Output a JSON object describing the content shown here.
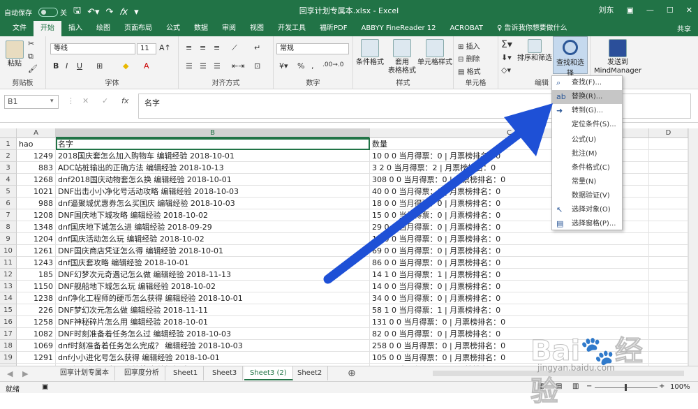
{
  "titlebar": {
    "autosave": "自动保存",
    "autosave_state": "关",
    "title": "回享计划专属本.xlsx  -  Excel",
    "user": "刘东"
  },
  "tabs": [
    "文件",
    "开始",
    "插入",
    "绘图",
    "页面布局",
    "公式",
    "数据",
    "审阅",
    "视图",
    "开发工具",
    "福昕PDF",
    "ABBYY FineReader 12",
    "ACROBAT",
    "♀ 告诉我你想要做什么"
  ],
  "tabs_active": 1,
  "share": "共享",
  "ribbon": {
    "paste": "粘贴",
    "clipboard": "剪贴板",
    "font_name": "等线",
    "font_size": "11",
    "font_group": "字体",
    "align_group": "对齐方式",
    "number_format": "常规",
    "number_group": "数字",
    "cond_format": "条件格式",
    "table_format": "套用\n表格格式",
    "cell_style": "单元格样式",
    "style_group": "样式",
    "insert": "插入",
    "delete": "删除",
    "format": "格式",
    "cells_group": "单元格",
    "sort_filter": "排序和筛选",
    "find_select": "查找和选择",
    "edit_group": "编辑",
    "send_mindmanager": "发送到\nMindManager"
  },
  "formula_bar": {
    "name_box": "B1",
    "fx": "fx",
    "content": "名字"
  },
  "columns": [
    "A",
    "B",
    "C",
    "D"
  ],
  "rows": [
    {
      "n": "1",
      "a": "hao",
      "b": "名字",
      "c": "数量"
    },
    {
      "n": "2",
      "a": "1249",
      "b": "2018国庆套怎么加入购物车 编辑经验 2018-10-01",
      "c": "10 0 0 当月得票：0 | 月票榜排名：0"
    },
    {
      "n": "3",
      "a": "883",
      "b": "ADC站桩输出的正确方法 编辑经验 2018-10-13",
      "c": "3 2 0 当月得票：2 | 月票榜排名：0"
    },
    {
      "n": "4",
      "a": "1268",
      "b": "dnf2018国庆动物套怎么换 编辑经验 2018-10-01",
      "c": "308 0 0 当月得票：0 | 月票榜排名：0"
    },
    {
      "n": "5",
      "a": "1021",
      "b": "DNF出击小小净化号活动攻略 编辑经验 2018-10-03",
      "c": "40 0 0 当月得票：0 | 月票榜排名：0"
    },
    {
      "n": "6",
      "a": "988",
      "b": "dnf逼聚城优惠券怎么买国庆 编辑经验 2018-10-03",
      "c": "18 0 0 当月得票：0 | 月票榜排名：0"
    },
    {
      "n": "7",
      "a": "1208",
      "b": "DNF国庆地下城攻略 编辑经验 2018-10-02",
      "c": "15 0 0 当月得票：0 | 月票榜排名：0"
    },
    {
      "n": "8",
      "a": "1348",
      "b": "dnf国庆地下城怎么进 编辑经验 2018-09-29",
      "c": "29 0 0 当月得票：0 | 月票榜排名：0"
    },
    {
      "n": "9",
      "a": "1204",
      "b": "dnf国庆活动怎么玩 编辑经验 2018-10-02",
      "c": "11 0 0 当月得票：0 | 月票榜排名：0"
    },
    {
      "n": "10",
      "a": "1261",
      "b": "DNF国庆商店凭证怎么得 编辑经验 2018-10-01",
      "c": "69 0 0 当月得票：0 | 月票榜排名：0"
    },
    {
      "n": "11",
      "a": "1243",
      "b": "dnf国庆套攻略 编辑经验 2018-10-01",
      "c": "86 0 0 当月得票：0 | 月票榜排名：0"
    },
    {
      "n": "12",
      "a": "185",
      "b": "DNF幻梦次元奇遇记怎么做 编辑经验 2018-11-13",
      "c": "14 1 0 当月得票：1 | 月票榜排名：0"
    },
    {
      "n": "13",
      "a": "1150",
      "b": "DNF舰船地下城怎么玩 编辑经验 2018-10-02",
      "c": "14 0 0 当月得票：0 | 月票榜排名：0"
    },
    {
      "n": "14",
      "a": "1238",
      "b": "dnf净化工程师的硬币怎么获得 编辑经验 2018-10-01",
      "c": "34 0 0 当月得票：0 | 月票榜排名：0"
    },
    {
      "n": "15",
      "a": "226",
      "b": "DNF梦幻次元怎么做 编辑经验 2018-11-11",
      "c": "58 1 0 当月得票：1 | 月票榜排名：0"
    },
    {
      "n": "16",
      "a": "1258",
      "b": "DNF神秘碎片怎么用 编辑经验 2018-10-01",
      "c": "131 0 0 当月得票：0 | 月票榜排名：0"
    },
    {
      "n": "17",
      "a": "1082",
      "b": "DNF时刻准备着任务怎么过 编辑经验 2018-10-03",
      "c": "82 0 0 当月得票：0 | 月票榜排名：0"
    },
    {
      "n": "18",
      "a": "1069",
      "b": "dnf时刻准备着任务怎么完成？ 编辑经验 2018-10-03",
      "c": "258 0 0 当月得票：0 | 月票榜排名：0"
    },
    {
      "n": "19",
      "a": "1291",
      "b": "dnf小小进化号怎么获得 编辑经验 2018-10-01",
      "c": "105 0 0 当月得票：0 | 月票榜排名：0"
    },
    {
      "n": "20",
      "a": "1030",
      "b": "dnf小小净化号怎么出战特殊 编辑经验 2018-10-03",
      "c": "18 0 0 当月得票：0 | 月票榜排名：0"
    },
    {
      "n": "21",
      "a": "1093",
      "b": "dnf小小净化号怎么派遣 编辑经验 2018-10-03",
      "c": "18 0 0 当月得票：0 | 月票榜排名：0"
    },
    {
      "n": "22",
      "a": "1090",
      "b": "dnf小小净化号怎么去特殊 编辑经验 2018-10-03",
      "c": "82 0 0 当月得票：0 | 月票榜排名：0"
    }
  ],
  "sheets": [
    "回享计划专属本",
    "回享度分析",
    "Sheet1",
    "Sheet3",
    "Sheet3 (2)",
    "Sheet2"
  ],
  "sheets_active": 4,
  "status": {
    "mode": "就绪",
    "zoom": "100%"
  },
  "menu": [
    {
      "label": "查找(F)...",
      "icon": "search-icon"
    },
    {
      "label": "替换(R)...",
      "icon": "replace-icon",
      "highlight": true
    },
    {
      "label": "转到(G)...",
      "icon": "goto-arrow-icon"
    },
    {
      "label": "定位条件(S)...",
      "icon": ""
    },
    {
      "label": "公式(U)",
      "icon": ""
    },
    {
      "label": "批注(M)",
      "icon": ""
    },
    {
      "label": "条件格式(C)",
      "icon": ""
    },
    {
      "label": "常量(N)",
      "icon": ""
    },
    {
      "label": "数据验证(V)",
      "icon": ""
    },
    {
      "label": "选择对象(O)",
      "icon": "cursor-icon"
    },
    {
      "label": "选择窗格(P)...",
      "icon": "selection-pane-icon"
    }
  ],
  "watermark": {
    "brand": "Bai",
    "brand2": "经验",
    "url": "jingyan.baidu.com"
  },
  "colors": {
    "excel_green": "#217346",
    "arrow": "#1e50d6"
  }
}
